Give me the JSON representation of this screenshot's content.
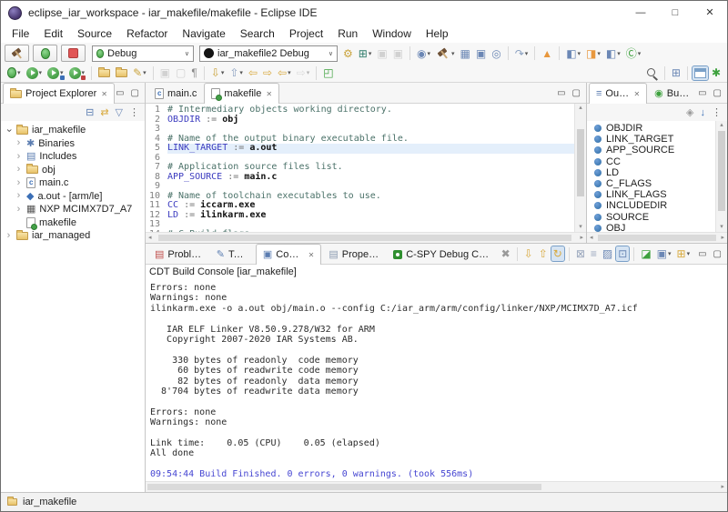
{
  "window": {
    "title": "eclipse_iar_workspace - iar_makefile/makefile - Eclipse IDE",
    "controls": {
      "minimize": "—",
      "maximize": "□",
      "close": "✕"
    }
  },
  "glyphs": {
    "caret": "▾",
    "combo_caret": "∨",
    "close": "✕",
    "minimize": "▭",
    "maximize": "▢",
    "chevron": "›",
    "gear": "⚙",
    "up": "▴",
    "down": "▾",
    "left": "◂",
    "right": "▸"
  },
  "menu": [
    "File",
    "Edit",
    "Source",
    "Refactor",
    "Navigate",
    "Search",
    "Project",
    "Run",
    "Window",
    "Help"
  ],
  "launchbar": {
    "debug_combo": "Debug",
    "launch_combo": "iar_makefile2 Debug"
  },
  "toolbar1": [
    {
      "name": "new-wizard-icon",
      "g": "⊞",
      "c": "#2f7d6b",
      "dd": true
    },
    {
      "name": "save-icon",
      "g": "▣",
      "c": "#9a9a9a",
      "disabled": true
    },
    {
      "name": "save-all-icon",
      "g": "▣",
      "c": "#9a9a9a",
      "disabled": true
    },
    {
      "sep": true
    },
    {
      "name": "debug-config-icon",
      "g": "◉",
      "c": "#6b87b5",
      "dd": true
    },
    {
      "name": "build-icon",
      "css": "icon-hammer",
      "dd": true
    },
    {
      "name": "build-all-icon",
      "g": "▦",
      "c": "#6b87b5"
    },
    {
      "name": "console-display-icon",
      "g": "▣",
      "c": "#6b87b5"
    },
    {
      "name": "search-source-icon",
      "g": "◎",
      "c": "#6b87b5"
    },
    {
      "sep": true
    },
    {
      "name": "skip-breakpoints-icon",
      "g": "↷",
      "c": "#8aa0c0",
      "dd": true
    },
    {
      "sep": true
    },
    {
      "name": "warning-icon",
      "g": "▲",
      "c": "#e8973d"
    },
    {
      "sep": true
    },
    {
      "name": "new-c-project-icon",
      "g": "◧",
      "c": "#6b87b5",
      "dd": true
    },
    {
      "name": "new-cpp-project-icon",
      "g": "◨",
      "c": "#e8973d",
      "dd": true
    },
    {
      "name": "new-file-wizard-icon",
      "g": "◧",
      "c": "#6b87b5",
      "dd": true
    },
    {
      "name": "launch-group-icon",
      "g": "Ⓒ",
      "c": "#3da13d",
      "dd": true
    }
  ],
  "toolbar2": [
    {
      "name": "debug-icon",
      "css": "icon-bugsym",
      "dd": true
    },
    {
      "name": "run-icon",
      "css": "icon-run",
      "dd": true
    },
    {
      "name": "run-coverage-icon",
      "css": "icon-run",
      "badge": "#3b6fb6",
      "dd": true
    },
    {
      "name": "profile-icon",
      "css": "icon-run",
      "badge": "#c04040",
      "dd": true
    },
    {
      "sep": true
    },
    {
      "name": "open-folder-icon",
      "css": "icon-folder"
    },
    {
      "name": "import-folder-icon",
      "css": "icon-folder"
    },
    {
      "name": "mark-occurrences-icon",
      "g": "✎",
      "c": "#c9a23a",
      "dd": true
    },
    {
      "sep": true
    },
    {
      "name": "build-working-set-icon",
      "g": "▣",
      "c": "#9a9a9a",
      "disabled": true
    },
    {
      "name": "stop-build-icon",
      "g": "▢",
      "c": "#9a9a9a",
      "disabled": true
    },
    {
      "name": "show-whitespace-icon",
      "g": "¶",
      "c": "#8a8a8a"
    },
    {
      "sep": true
    },
    {
      "name": "last-edit-location-icon",
      "g": "⇩",
      "c": "#c9a23a",
      "dd": true
    },
    {
      "name": "next-annotation-icon",
      "g": "⇧",
      "c": "#8aa0c0",
      "dd": true
    },
    {
      "name": "back-curved-icon",
      "g": "⇦",
      "c": "#d8a93d"
    },
    {
      "name": "forward-curved-icon",
      "g": "⇨",
      "c": "#d8a93d"
    },
    {
      "name": "back-history-icon",
      "g": "⇦",
      "c": "#d8a93d",
      "dd": true
    },
    {
      "name": "forward-history-icon",
      "g": "⇨",
      "c": "#b5b5b5",
      "dd": true,
      "disabled": true
    },
    {
      "sep": true
    },
    {
      "name": "new-window-icon",
      "g": "◰",
      "c": "#3da13d"
    }
  ],
  "toolbar_right": [
    {
      "name": "search-icon",
      "css": "icon-mag"
    },
    {
      "sep": true
    },
    {
      "name": "open-perspective-icon",
      "g": "⊞",
      "c": "#6b87b5"
    },
    {
      "sep": true
    },
    {
      "name": "c-perspective-button",
      "css": "icon-persp",
      "active": true
    },
    {
      "name": "debug-perspective-button",
      "g": "✱",
      "c": "#3da13d"
    }
  ],
  "project_explorer": {
    "tabs": [
      {
        "name": "tab-project-explorer",
        "label": "Project Explorer",
        "icon": "folder",
        "active": true,
        "closable": true
      }
    ],
    "view_icons": [
      {
        "name": "collapse-all-icon",
        "g": "⊟",
        "c": "#5b7db1"
      },
      {
        "name": "link-with-editor-icon",
        "g": "⇄",
        "c": "#d8a93d"
      },
      {
        "name": "filter-icon",
        "g": "▽",
        "c": "#6b87b5"
      },
      {
        "name": "view-menu-icon",
        "g": "⋮",
        "c": "#666666"
      }
    ],
    "tree": [
      {
        "label": "iar_makefile",
        "icon": "folder",
        "depth": 0,
        "state": "expanded"
      },
      {
        "label": "Binaries",
        "icon": "binaries",
        "depth": 1,
        "state": "collapsed"
      },
      {
        "label": "Includes",
        "icon": "includes",
        "depth": 1,
        "state": "collapsed"
      },
      {
        "label": "obj",
        "icon": "folder",
        "depth": 1,
        "state": "collapsed"
      },
      {
        "label": "main.c",
        "icon": "cfile",
        "depth": 1,
        "state": "collapsed"
      },
      {
        "label": "a.out - [arm/le]",
        "icon": "executable",
        "depth": 1,
        "state": "collapsed"
      },
      {
        "label": "NXP MCIMX7D7_A7",
        "icon": "chip",
        "depth": 1,
        "state": "collapsed"
      },
      {
        "label": "makefile",
        "icon": "makefile",
        "depth": 1,
        "state": "none"
      },
      {
        "label": "iar_managed",
        "icon": "folder",
        "depth": 0,
        "state": "collapsed"
      }
    ]
  },
  "editor": {
    "tabs": [
      {
        "name": "tab-main-c",
        "label": "main.c",
        "icon": "cfile"
      },
      {
        "name": "tab-makefile",
        "label": "makefile",
        "icon": "makefile",
        "active": true,
        "closable": true
      }
    ],
    "lines": [
      {
        "n": 1,
        "p": [
          [
            "c",
            "# Intermediary objects working directory."
          ]
        ]
      },
      {
        "n": 2,
        "p": [
          [
            "v",
            "OBJDIR"
          ],
          [
            "o",
            " := "
          ],
          [
            "b",
            "obj"
          ]
        ]
      },
      {
        "n": 3,
        "p": []
      },
      {
        "n": 4,
        "p": [
          [
            "c",
            "# Name of the output binary executable file."
          ]
        ]
      },
      {
        "n": 5,
        "hl": true,
        "p": [
          [
            "v",
            "LINK_TARGET"
          ],
          [
            "o",
            " := "
          ],
          [
            "b",
            "a.out"
          ]
        ]
      },
      {
        "n": 6,
        "p": []
      },
      {
        "n": 7,
        "p": [
          [
            "c",
            "# Application source files list."
          ]
        ]
      },
      {
        "n": 8,
        "p": [
          [
            "v",
            "APP_SOURCE"
          ],
          [
            "o",
            " := "
          ],
          [
            "b",
            "main.c"
          ]
        ]
      },
      {
        "n": 9,
        "p": []
      },
      {
        "n": 10,
        "p": [
          [
            "c",
            "# Name of toolchain executables to use."
          ]
        ]
      },
      {
        "n": 11,
        "p": [
          [
            "v",
            "CC"
          ],
          [
            "o",
            " := "
          ],
          [
            "b",
            "iccarm.exe"
          ]
        ]
      },
      {
        "n": 12,
        "p": [
          [
            "v",
            "LD"
          ],
          [
            "o",
            " := "
          ],
          [
            "b",
            "ilinkarm.exe"
          ]
        ]
      },
      {
        "n": 13,
        "p": []
      },
      {
        "n": 14,
        "p": [
          [
            "c",
            "# C Build flags"
          ]
        ]
      }
    ]
  },
  "outline": {
    "tabs": [
      {
        "name": "tab-outline",
        "label": "Outline",
        "icon": "outline",
        "active": true,
        "closable": true
      },
      {
        "name": "tab-build-targets",
        "label": "Build...",
        "icon": "buildtargets"
      }
    ],
    "view_icons": [
      {
        "name": "custom-filter-icon",
        "g": "◈",
        "c": "#9a9a9a"
      },
      {
        "name": "sort-alphabetically-icon",
        "g": "↓",
        "c": "#3b6fb6"
      },
      {
        "name": "view-menu-icon",
        "g": "⋮",
        "c": "#666666"
      }
    ],
    "items": [
      "OBJDIR",
      "LINK_TARGET",
      "APP_SOURCE",
      "CC",
      "LD",
      "C_FLAGS",
      "LINK_FLAGS",
      "INCLUDEDIR",
      "SOURCE",
      "OBJ"
    ]
  },
  "console": {
    "tabs": [
      {
        "name": "tab-problems",
        "label": "Problems",
        "icon": "problems"
      },
      {
        "name": "tab-tasks",
        "label": "Tasks",
        "icon": "tasks"
      },
      {
        "name": "tab-console",
        "label": "Console",
        "icon": "console",
        "active": true,
        "closable": true
      },
      {
        "name": "tab-properties",
        "label": "Properties",
        "icon": "properties"
      },
      {
        "name": "tab-cspy-debug-console",
        "label": "C-SPY Debug Console",
        "icon": "cspy"
      }
    ],
    "toolbar_icons": [
      {
        "name": "close-console-icon",
        "g": "✖",
        "c": "#9a9a9a"
      },
      {
        "sep": true
      },
      {
        "name": "next-error-icon",
        "g": "⇩",
        "c": "#d8a93d"
      },
      {
        "name": "previous-error-icon",
        "g": "⇧",
        "c": "#d8a93d"
      },
      {
        "name": "show-skipped-icon",
        "g": "↻",
        "c": "#d8a93d",
        "active": true
      },
      {
        "sep": true
      },
      {
        "name": "lock-scroll-icon",
        "g": "⊠",
        "c": "#9aa7bd"
      },
      {
        "name": "word-wrap-icon",
        "g": "≡",
        "c": "#9aa7bd"
      },
      {
        "name": "clear-console-icon",
        "g": "▨",
        "c": "#6b87b5"
      },
      {
        "name": "scroll-lock-icon",
        "g": "⊡",
        "c": "#6b87b5",
        "active": true
      },
      {
        "sep": true
      },
      {
        "name": "pin-console-icon",
        "g": "◪",
        "c": "#3da13d"
      },
      {
        "name": "display-console-icon",
        "g": "▣",
        "c": "#6b87b5",
        "dd": true
      },
      {
        "name": "open-console-icon",
        "g": "⊞",
        "c": "#d8a93d",
        "dd": true
      }
    ],
    "subtitle": "CDT Build Console [iar_makefile]",
    "lines": [
      {
        "t": "Errors: none"
      },
      {
        "t": "Warnings: none"
      },
      {
        "t": "ilinkarm.exe -o a.out obj/main.o --config C:/iar_arm/arm/config/linker/NXP/MCIMX7D_A7.icf"
      },
      {
        "t": ""
      },
      {
        "t": "   IAR ELF Linker V8.50.9.278/W32 for ARM"
      },
      {
        "t": "   Copyright 2007-2020 IAR Systems AB."
      },
      {
        "t": ""
      },
      {
        "t": "    330 bytes of readonly  code memory"
      },
      {
        "t": "     60 bytes of readwrite code memory"
      },
      {
        "t": "     82 bytes of readonly  data memory"
      },
      {
        "t": "  8'704 bytes of readwrite data memory"
      },
      {
        "t": ""
      },
      {
        "t": "Errors: none"
      },
      {
        "t": "Warnings: none"
      },
      {
        "t": ""
      },
      {
        "t": "Link time:    0.05 (CPU)    0.05 (elapsed)"
      },
      {
        "t": "All done"
      },
      {
        "t": ""
      },
      {
        "t": "09:54:44 Build Finished. 0 errors, 0 warnings. (took 556ms)",
        "c": "info"
      }
    ]
  },
  "status_bar": {
    "project": "iar_makefile"
  },
  "colors": {
    "comment": "#4a7168",
    "variable": "#3b3bbf",
    "operator": "#707070",
    "console_info": "#4646d2",
    "current_line": "#e4effb",
    "accent_blue": "#3b6fb6"
  }
}
